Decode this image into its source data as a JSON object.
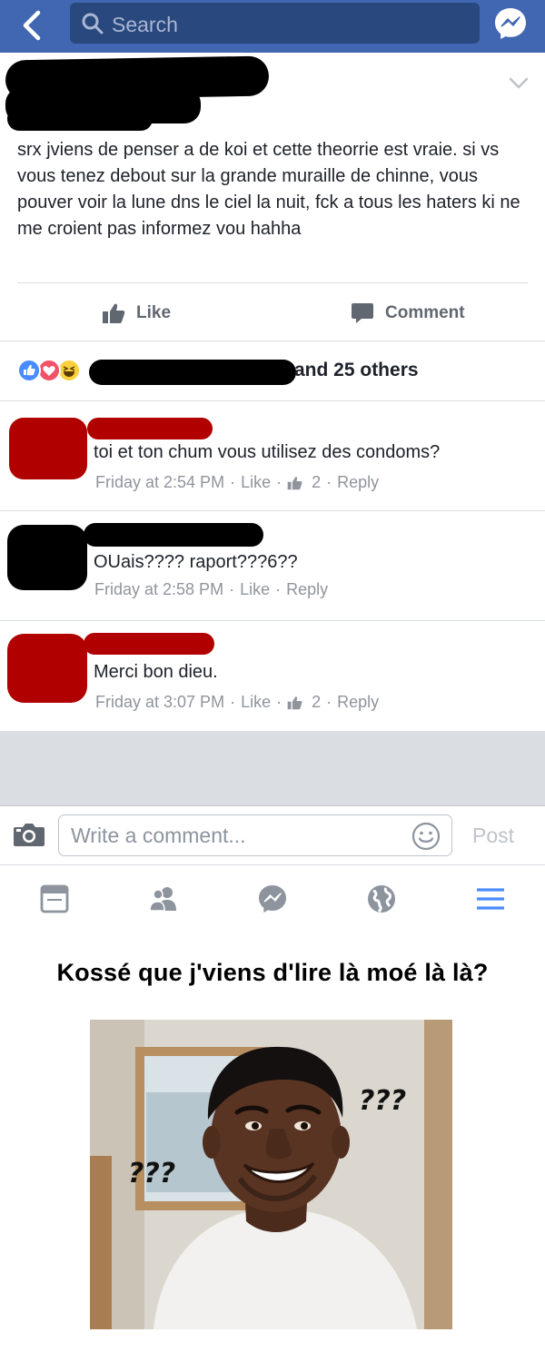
{
  "colors": {
    "brand": "#4267b2",
    "search_bg": "#29487d",
    "muted": "#90949c",
    "redaction_red": "#b10000"
  },
  "header": {
    "search_placeholder": "Search",
    "back_icon": "back-chevron-icon",
    "messenger_icon": "messenger-icon"
  },
  "post": {
    "text": "srx jviens de penser a de koi et cette theorrie est vraie. si vs vous tenez debout sur la grande muraille de chinne, vous pouver voir la lune dns le ciel la nuit, fck a tous les haters ki ne me croient pas informez vou hahha",
    "like_label": "Like",
    "comment_label": "Comment",
    "reactions_summary": "and 25 others"
  },
  "comments": [
    {
      "text": "toi et ton chum vous utilisez des condoms?",
      "time": "Friday at 2:54 PM",
      "like": "Like",
      "likes_count": "2",
      "reply": "Reply"
    },
    {
      "text": "OUais???? raport???6??",
      "time": "Friday at 2:58 PM",
      "like": "Like",
      "likes_count": "",
      "reply": "Reply"
    },
    {
      "text": "Merci bon dieu.",
      "time": "Friday at 3:07 PM",
      "like": "Like",
      "likes_count": "2",
      "reply": "Reply"
    }
  ],
  "composer": {
    "placeholder": "Write a comment...",
    "post_label": "Post"
  },
  "tabbar": {
    "icons": [
      "news-feed-icon",
      "friends-icon",
      "messenger-icon",
      "globe-icon",
      "menu-icon"
    ]
  },
  "meme": {
    "caption": "Kossé que j'viens d'lire là moé là là?",
    "left_marks": "???",
    "right_marks": "???"
  }
}
